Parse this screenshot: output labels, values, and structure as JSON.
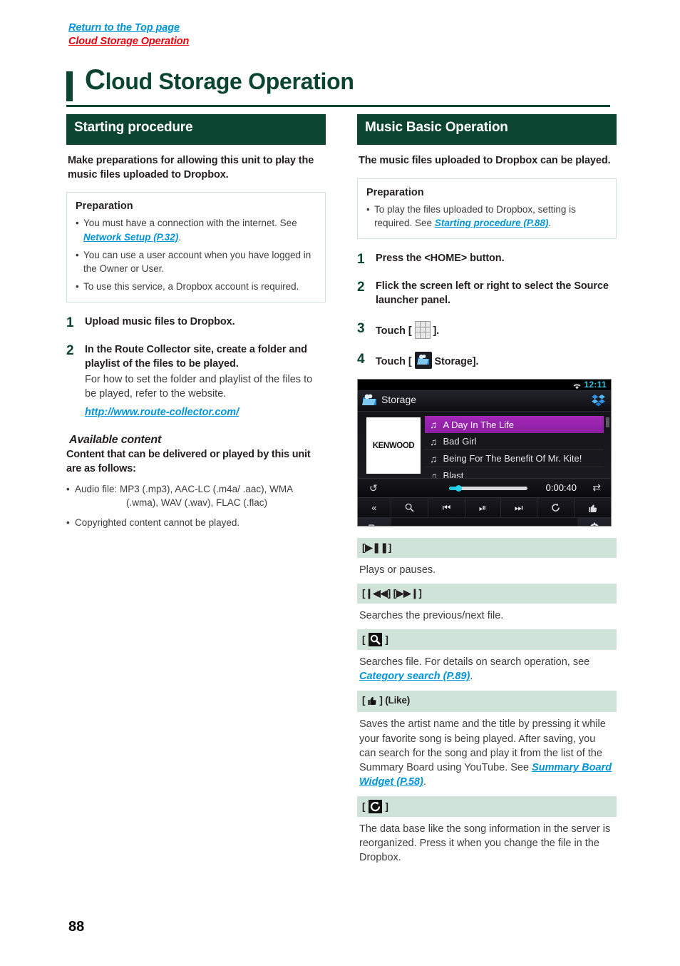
{
  "breadcrumbs": {
    "top_link": "Return to the Top page",
    "current": "Cloud Storage Operation"
  },
  "title": {
    "dropcap": "C",
    "rest": "loud Storage Operation"
  },
  "page_number": "88",
  "left_column": {
    "section_header": "Starting procedure",
    "lead": "Make preparations for allowing this unit to play the music files uploaded to Dropbox.",
    "preparation": {
      "title": "Preparation",
      "items": [
        {
          "text_before": "You must have a connection with the internet. See ",
          "link": "Network Setup (P.32)",
          "text_after": "."
        },
        {
          "text_before": "You can use a user account when you have logged in the Owner or User.",
          "link": "",
          "text_after": ""
        },
        {
          "text_before": "To use this service, a Dropbox account is required.",
          "link": "",
          "text_after": ""
        }
      ]
    },
    "steps": [
      {
        "num": "1",
        "title": "Upload music files to Dropbox.",
        "desc": "",
        "link": ""
      },
      {
        "num": "2",
        "title": "In the Route Collector site, create a folder and playlist of the files to be played.",
        "desc": "For how to set the folder and playlist of the files to be played, refer to the website.",
        "link": "http://www.route-collector.com/"
      }
    ],
    "available_content": {
      "heading": "Available content",
      "lead": "Content that can be delivered or played by this unit are as follows:",
      "items": [
        {
          "line1": "Audio file: MP3 (.mp3), AAC-LC (.m4a/ .aac), WMA",
          "line2": "(.wma), WAV (.wav), FLAC (.flac)"
        },
        {
          "line1": "Copyrighted content cannot be played.",
          "line2": ""
        }
      ]
    }
  },
  "right_column": {
    "section_header": "Music Basic Operation",
    "lead": "The music files uploaded to Dropbox can be played.",
    "preparation": {
      "title": "Preparation",
      "items": [
        {
          "text_before": "To play the files uploaded to Dropbox, setting is required. See ",
          "link": "Starting procedure (P.88)",
          "text_after": "."
        }
      ]
    },
    "steps": [
      {
        "num": "1",
        "title": "Press the <HOME> button."
      },
      {
        "num": "2",
        "title": "Flick the screen left or right to select the Source launcher panel."
      },
      {
        "num": "3",
        "title_before": "Touch [",
        "icon": "grid-icon",
        "title_after": "]."
      },
      {
        "num": "4",
        "title_before": "Touch [",
        "icon": "cloud-folder-icon",
        "title_after": "Storage]."
      }
    ],
    "device_screenshot": {
      "status_bar": {
        "clock": "12:11",
        "wifi_icon": "wifi-icon"
      },
      "title_bar": {
        "icon": "cloud-folder-icon",
        "label": "Storage",
        "right_icon": "dropbox-icon"
      },
      "album_art_label": "KENWOOD",
      "playlist": [
        {
          "title": "A Day In The Life",
          "selected": true
        },
        {
          "title": "Bad Girl",
          "selected": false
        },
        {
          "title": "Being For The Benefit Of Mr. Kite!",
          "selected": false
        },
        {
          "title": "Blast",
          "selected": false
        }
      ],
      "seek_bar": {
        "time": "0:00:40",
        "repeat_icon": "repeat-icon",
        "shuffle_icon": "shuffle-icon"
      },
      "controls": [
        "chevrons-left-icon",
        "search-icon",
        "previous-icon",
        "play-pause-icon",
        "next-icon",
        "refresh-icon",
        "like-icon"
      ],
      "bottom_bar": {
        "left_icon": "list-search-icon",
        "right_icon": "gear-icon"
      }
    },
    "function_table": [
      {
        "header_text": "[",
        "header_icon": "play-pause-glyph",
        "header_text_end": "]",
        "header_plain": "[▶❚❚]",
        "body_before": "Plays or pauses.",
        "body_link": "",
        "body_after": ""
      },
      {
        "header_plain": "[❙◀◀] [▶▶❙]",
        "body_before": "Searches the previous/next file.",
        "body_link": "",
        "body_after": ""
      },
      {
        "header_plain": "[ ",
        "header_icon_name": "search-icon",
        "header_plain_end": " ]",
        "body_before": "Searches file. For details on search operation, see ",
        "body_link": "Category search (P.89)",
        "body_after": "."
      },
      {
        "header_plain": "[ ",
        "header_icon_name": "like-icon",
        "header_plain_end": " ] (Like)",
        "body_before": "Saves the artist name and the title by pressing it while your favorite song is being played. After saving, you can search for the song and play it from the list of the Summary Board using YouTube. See ",
        "body_link": "Summary Board Widget (P.58)",
        "body_after": "."
      },
      {
        "header_plain": "[ ",
        "header_icon_name": "refresh-icon",
        "header_plain_end": " ]",
        "body_before": "The data base like the song information in the server is reorganized. Press it when you change the file in the Dropbox.",
        "body_link": "",
        "body_after": ""
      }
    ]
  }
}
